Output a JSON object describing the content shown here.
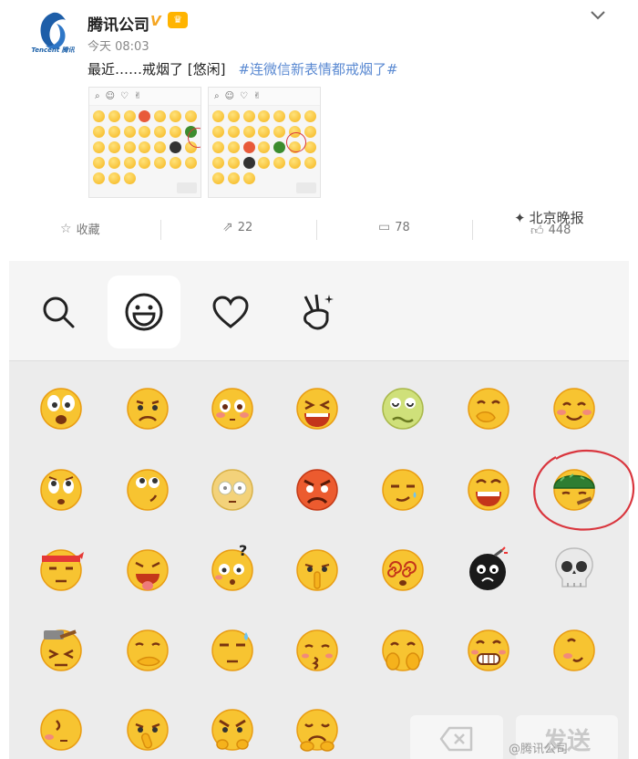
{
  "post": {
    "author": "腾讯公司",
    "verified_mark": "V",
    "time": "今天 08:03",
    "text": "最近……戒烟了 [悠闲]",
    "hashtag": "#连微信新表情都戒烟了#",
    "avatar_caption": "Tencent 腾讯"
  },
  "actions": {
    "favorite": "收藏",
    "share_count": "22",
    "comment_count": "78",
    "like_count": "448"
  },
  "watermark": {
    "top": "北京晚报",
    "bottom": "@腾讯公司"
  },
  "panel": {
    "tabs": [
      {
        "name": "search-icon",
        "active": false
      },
      {
        "name": "smiley-icon",
        "active": true
      },
      {
        "name": "heart-icon",
        "active": false
      },
      {
        "name": "peace-hand-icon",
        "active": false
      }
    ],
    "send_label": "发送",
    "highlight_color": "#d9363e"
  }
}
